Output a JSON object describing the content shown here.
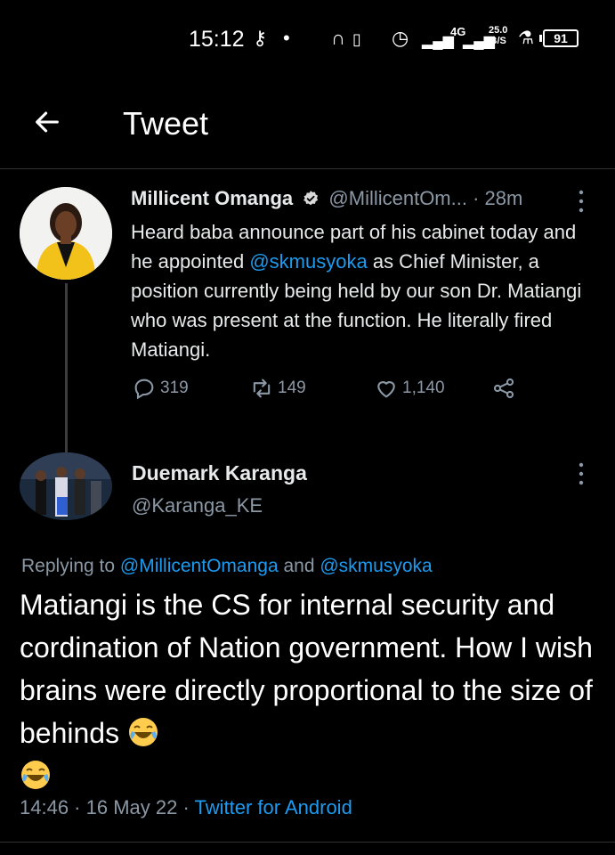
{
  "status_bar": {
    "time": "15:12",
    "network": "4G",
    "speed_value": "25.0",
    "speed_unit": "B/S",
    "battery": "91"
  },
  "header": {
    "title": "Tweet"
  },
  "parent_tweet": {
    "name": "Millicent Omanga",
    "handle": "@MillicentOm...",
    "time": "· 28m",
    "text_1": "Heard baba announce part of his cabinet today and he appointed ",
    "mention": "@skmusyoka",
    "text_2": " as Chief Minister, a position currently being held by our son Dr. Matiangi who was present at the function. He literally fired Matiangi.",
    "replies": "319",
    "retweets": "149",
    "likes": "1,140"
  },
  "reply_tweet": {
    "name": "Duemark Karanga",
    "handle": "@Karanga_KE",
    "replying_label": "Replying to ",
    "replying_to_1": "@MillicentOmanga",
    "replying_and": " and ",
    "replying_to_2": "@skmusyoka",
    "text": "Matiangi is the CS for internal security and cordination of Nation government. How I wish brains were directly proportional to the size of behinds ",
    "timestamp": "14:46 · 16 May 22 · ",
    "source": "Twitter for Android"
  },
  "colors": {
    "background": "#000000",
    "accent": "#1d9bf0",
    "muted": "#8b98a5",
    "verified": "#d9d9d9"
  },
  "icons": [
    "back-arrow-icon",
    "verified-badge-icon",
    "more-options-icon",
    "reply-icon",
    "retweet-icon",
    "like-icon",
    "share-icon",
    "laughing-emoji-icon"
  ]
}
